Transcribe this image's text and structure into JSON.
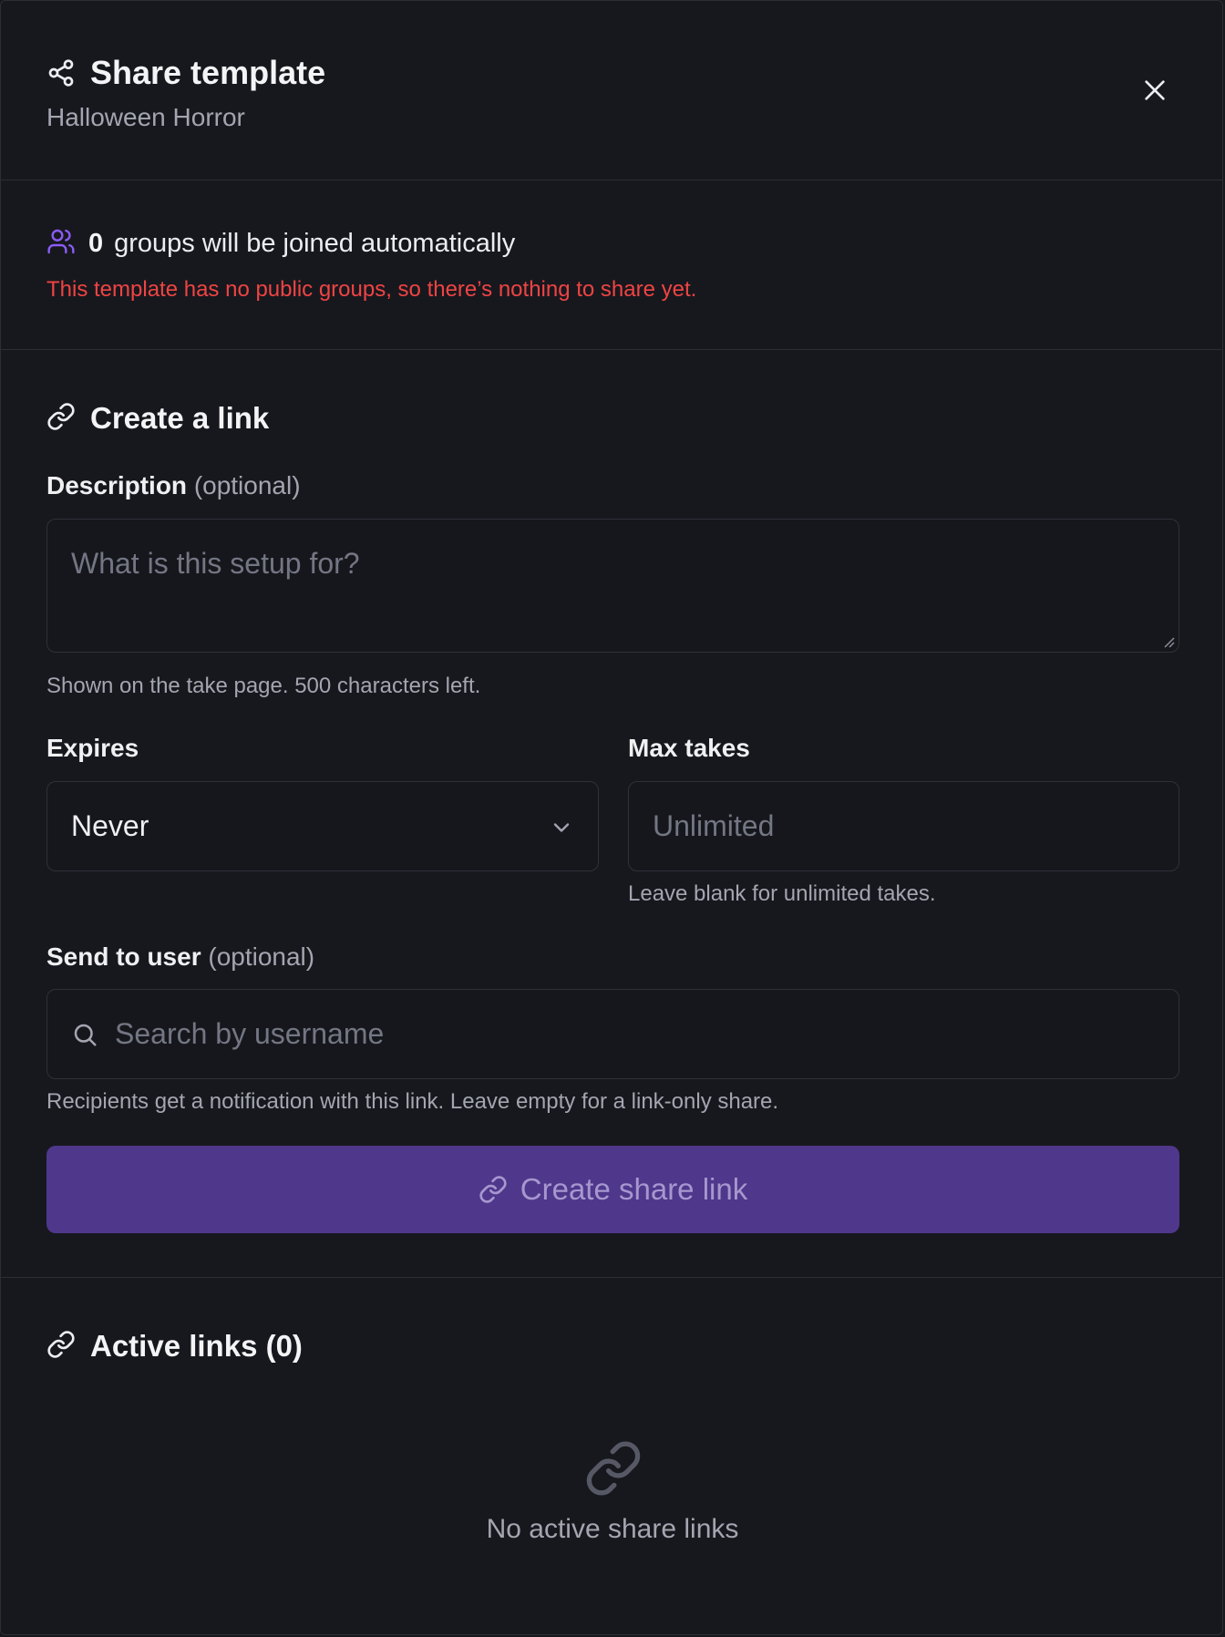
{
  "dialog": {
    "title": "Share template",
    "subtitle": "Halloween Horror"
  },
  "groups": {
    "count": "0",
    "text": "groups will be joined automatically",
    "warning": "This template has no public groups, so there’s nothing to share yet."
  },
  "create_link": {
    "heading": "Create a link",
    "description": {
      "label": "Description",
      "optional": "(optional)",
      "placeholder": "What is this setup for?",
      "hint": "Shown on the take page. 500 characters left."
    },
    "expires": {
      "label": "Expires",
      "value": "Never"
    },
    "max_takes": {
      "label": "Max takes",
      "placeholder": "Unlimited",
      "hint": "Leave blank for unlimited takes."
    },
    "send_to_user": {
      "label": "Send to user",
      "optional": "(optional)",
      "placeholder": "Search by username",
      "hint": "Recipients get a notification with this link. Leave empty for a link-only share."
    },
    "button": "Create share link"
  },
  "active_links": {
    "heading": "Active links (0)",
    "empty": "No active share links"
  },
  "colors": {
    "background": "#17181d",
    "accent": "#4f378b",
    "warning": "#ef4444",
    "groups_icon": "#8b5cf6"
  },
  "icons": [
    "share-icon",
    "close-icon",
    "users-icon",
    "link-icon",
    "chevron-down-icon",
    "search-icon"
  ]
}
